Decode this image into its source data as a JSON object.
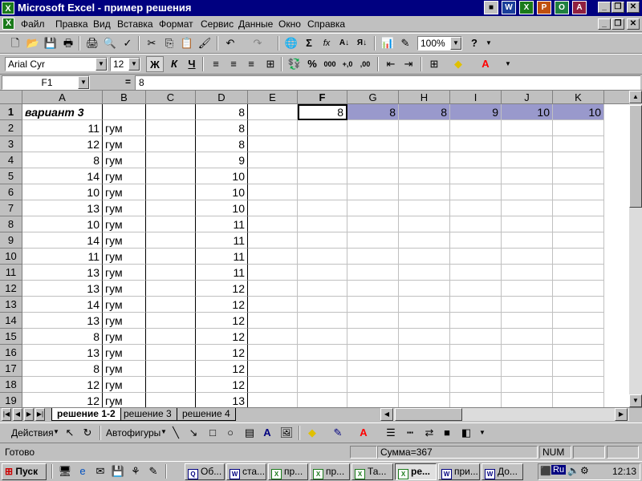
{
  "window": {
    "title": "Microsoft Excel - пример решения"
  },
  "menu": [
    "Файл",
    "Правка",
    "Вид",
    "Вставка",
    "Формат",
    "Сервис",
    "Данные",
    "Окно",
    "Справка"
  ],
  "toolbar": {
    "zoom": "100%",
    "font": "Arial Cyr",
    "size": "12",
    "bold": "Ж",
    "italic": "К",
    "underline": "Ч",
    "sigma": "Σ",
    "fx": "fx",
    "percent": "%",
    "thousands": "000",
    "inc_dec": "+,0",
    "dec_dec": ",00",
    "help": "?"
  },
  "formula": {
    "cellref": "F1",
    "eq": "=",
    "value": "8"
  },
  "columns": [
    "A",
    "B",
    "C",
    "D",
    "E",
    "F",
    "G",
    "H",
    "I",
    "J",
    "K"
  ],
  "rows": [
    {
      "n": "1",
      "A": "вариант 3",
      "B": "",
      "D": "8",
      "F": "8",
      "G": "8",
      "H": "8",
      "I": "9",
      "J": "10",
      "K": "10"
    },
    {
      "n": "2",
      "A": "11",
      "B": "гум",
      "D": "8"
    },
    {
      "n": "3",
      "A": "12",
      "B": "гум",
      "D": "8"
    },
    {
      "n": "4",
      "A": "8",
      "B": "гум",
      "D": "9"
    },
    {
      "n": "5",
      "A": "14",
      "B": "гум",
      "D": "10"
    },
    {
      "n": "6",
      "A": "10",
      "B": "гум",
      "D": "10"
    },
    {
      "n": "7",
      "A": "13",
      "B": "гум",
      "D": "10"
    },
    {
      "n": "8",
      "A": "10",
      "B": "гум",
      "D": "11"
    },
    {
      "n": "9",
      "A": "14",
      "B": "гум",
      "D": "11"
    },
    {
      "n": "10",
      "A": "11",
      "B": "гум",
      "D": "11"
    },
    {
      "n": "11",
      "A": "13",
      "B": "гум",
      "D": "11"
    },
    {
      "n": "12",
      "A": "13",
      "B": "гум",
      "D": "12"
    },
    {
      "n": "13",
      "A": "14",
      "B": "гум",
      "D": "12"
    },
    {
      "n": "14",
      "A": "13",
      "B": "гум",
      "D": "12"
    },
    {
      "n": "15",
      "A": "8",
      "B": "гум",
      "D": "12"
    },
    {
      "n": "16",
      "A": "13",
      "B": "гум",
      "D": "12"
    },
    {
      "n": "17",
      "A": "8",
      "B": "гум",
      "D": "12"
    },
    {
      "n": "18",
      "A": "12",
      "B": "гум",
      "D": "12"
    },
    {
      "n": "19",
      "A": "12",
      "B": "гум",
      "D": "13"
    }
  ],
  "sheets": {
    "tab1": "решение 1-2",
    "tab2": "решение 3",
    "tab3": "решение 4"
  },
  "drawbar": {
    "actions": "Действия",
    "autoshapes": "Автофигуры"
  },
  "status": {
    "ready": "Готово",
    "sum": "Сумма=367",
    "num": "NUM"
  },
  "taskbar": {
    "start": "Пуск",
    "tasks": [
      "Об...",
      "ста...",
      "пр...",
      "пр...",
      "Та...",
      "ре...",
      "при...",
      "До..."
    ],
    "lang": "Ru",
    "clock": "12:13"
  },
  "colors": {
    "titlebar": "#000080",
    "highlight": "#9999cc"
  }
}
